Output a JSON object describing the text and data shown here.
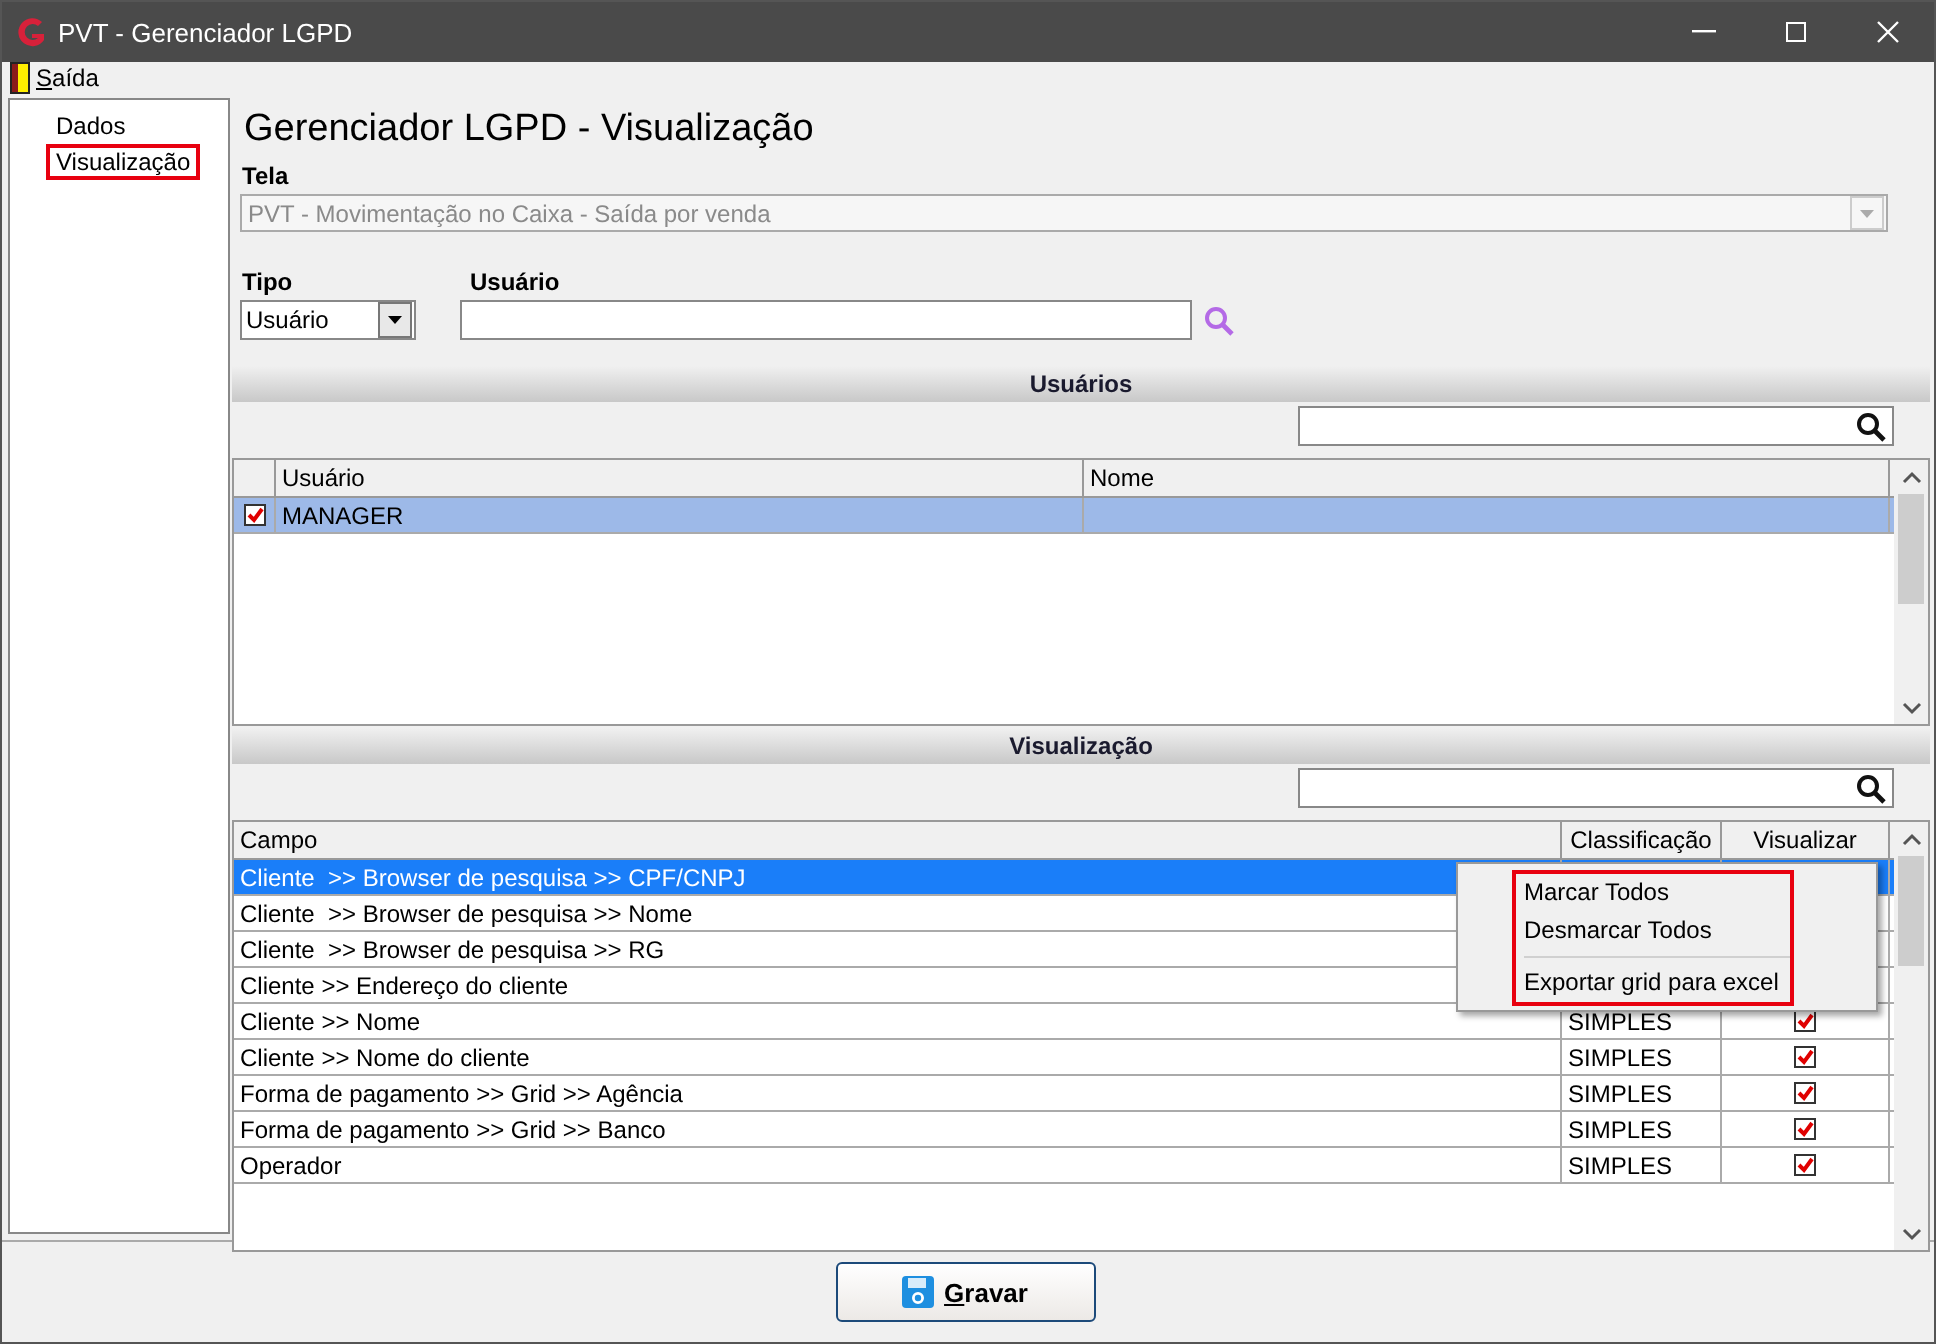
{
  "window": {
    "title": "PVT - Gerenciador LGPD"
  },
  "menu_bar": [
    {
      "label": "Saída"
    }
  ],
  "sidebar": {
    "items": [
      {
        "label": "Dados",
        "highlighted": false
      },
      {
        "label": "Visualização",
        "highlighted": true
      }
    ]
  },
  "page_title": "Gerenciador LGPD - Visualização",
  "tela": {
    "label": "Tela",
    "value": "PVT - Movimentação no Caixa - Saída por venda",
    "disabled": true
  },
  "tipo": {
    "label": "Tipo",
    "value": "Usuário"
  },
  "usuario": {
    "label": "Usuário"
  },
  "users_section": {
    "title": "Usuários",
    "columns": [
      "Usuário",
      "Nome"
    ],
    "rows": [
      {
        "usuario": "MANAGER",
        "checked": true,
        "selected": true
      }
    ]
  },
  "view_section": {
    "title": "Visualização",
    "columns": [
      "Campo",
      "Classificação",
      "Visualizar"
    ],
    "rows": [
      {
        "campo": "Cliente  >> Browser de pesquisa >> CPF/CNPJ",
        "selected": true
      },
      {
        "campo": "Cliente  >> Browser de pesquisa >> Nome",
        "selected": false
      },
      {
        "campo": "Cliente  >> Browser de pesquisa >> RG",
        "selected": false
      },
      {
        "campo": "Cliente >> Endereço do cliente",
        "selected": false
      },
      {
        "campo": "Cliente >> Nome",
        "classificacao": "SIMPLES",
        "visualizar": true,
        "selected": false
      },
      {
        "campo": "Cliente >> Nome do cliente",
        "classificacao": "SIMPLES",
        "visualizar": true,
        "selected": false
      },
      {
        "campo": "Forma de pagamento >> Grid >> Agência",
        "classificacao": "SIMPLES",
        "visualizar": true,
        "selected": false
      },
      {
        "campo": "Forma de pagamento >> Grid >> Banco",
        "classificacao": "SIMPLES",
        "visualizar": true,
        "selected": false
      },
      {
        "campo": "Operador",
        "classificacao": "SIMPLES",
        "visualizar": true,
        "selected": false
      }
    ]
  },
  "context_menu": {
    "highlighted": true,
    "items": [
      {
        "kind": "item",
        "label": "Marcar Todos"
      },
      {
        "kind": "item",
        "label": "Desmarcar Todos"
      },
      {
        "kind": "separator"
      },
      {
        "kind": "item",
        "label": "Exportar grid para excel"
      }
    ]
  },
  "save_button": {
    "label": "Gravar"
  }
}
